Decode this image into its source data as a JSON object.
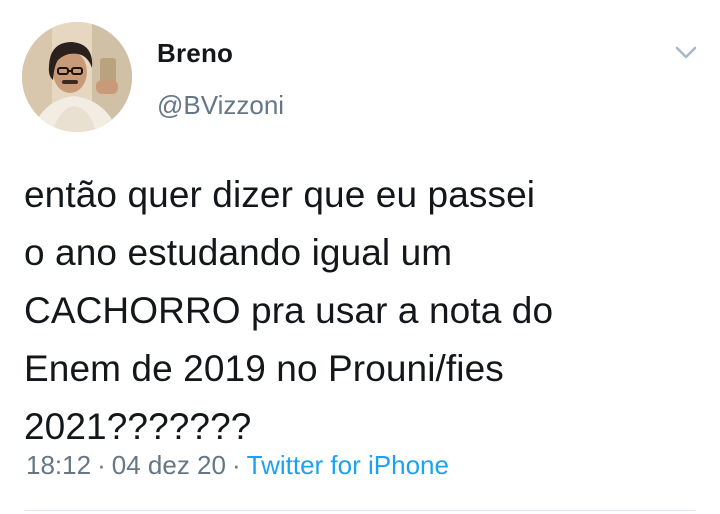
{
  "tweet": {
    "author": {
      "name": "Breno",
      "handle": "@BVizzoni"
    },
    "text": "então quer dizer que eu passei\no ano estudando igual um\nCACHORRO pra usar a nota do\nEnem de 2019 no Prouni/fies\n2021???????",
    "time": "18:12",
    "separator": "·",
    "date": "04 dez 20",
    "source": "Twitter for iPhone"
  },
  "icons": {
    "caret": "chevron-down-icon",
    "avatar": "profile-photo"
  },
  "colors": {
    "text": "#14171a",
    "secondary": "#657786",
    "link": "#1da1f2",
    "divider": "#e1e8ed"
  }
}
